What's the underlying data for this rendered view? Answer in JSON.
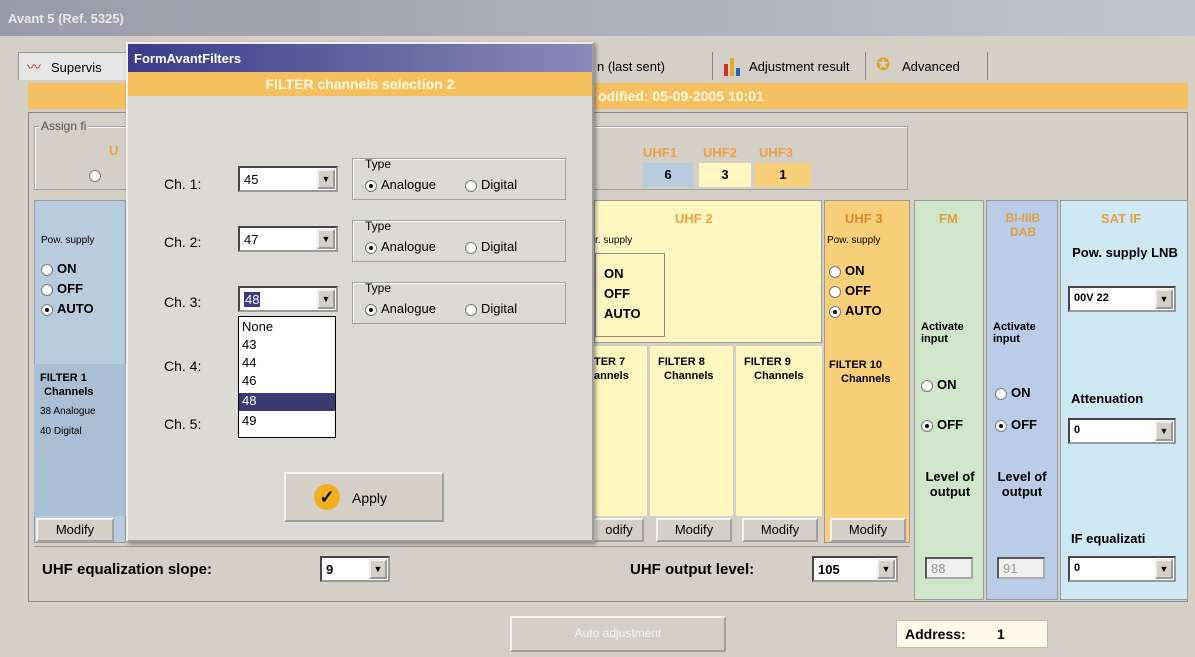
{
  "window": {
    "title": "Avant 5 (Ref. 5325)"
  },
  "tabs": [
    {
      "label": "Supervis",
      "icon": "waveform-icon"
    },
    {
      "label": "n (last sent)"
    },
    {
      "label": "Adjustment result",
      "icon": "bar-chart-icon"
    },
    {
      "label": "Advanced",
      "icon": "gear-icon"
    }
  ],
  "status": {
    "modified": "odified: 05-09-2005 10:01"
  },
  "assign_group": {
    "title": "Assign fi",
    "left_label": "U",
    "uhf_labels": [
      "UHF1",
      "UHF2",
      "UHF3"
    ],
    "uhf_values": [
      "6",
      "3",
      "1"
    ]
  },
  "bands": {
    "uhf2_title": "UHF 2",
    "uhf3_title": "UHF 3",
    "fm_title": "FM",
    "biiib_title": "BI-IIIB DAB",
    "satif_title": "SAT IF"
  },
  "pow_supply": {
    "label_left": "Pow. supply",
    "label_mid": "r. supply",
    "label_uhf3": "Pow. supply",
    "options": [
      "ON",
      "OFF",
      "AUTO"
    ],
    "selected": "AUTO"
  },
  "lnb": {
    "label": "Pow. supply LNB",
    "value": "00V 22"
  },
  "activate": {
    "label": "Activate input",
    "on": "ON",
    "off": "OFF"
  },
  "level": {
    "label": "Level of output",
    "fm_value": "88",
    "dab_value": "91"
  },
  "attenuation": {
    "label": "Attenuation",
    "value": "0"
  },
  "if_eq": {
    "label": "IF equalizati",
    "value": "0"
  },
  "filters": {
    "filter1": {
      "title": "FILTER 1",
      "sub": "Channels",
      "line1": "38 Analogue",
      "line2": "40 Digital"
    },
    "filter7": {
      "title": "TER 7",
      "sub": "annels"
    },
    "filter8": {
      "title": "FILTER 8",
      "sub": "Channels"
    },
    "filter9": {
      "title": "FILTER 9",
      "sub": "Channels"
    },
    "filter10": {
      "title": "FILTER 10",
      "sub": "Channels"
    },
    "modify": "Modify",
    "modify_partial": "odify"
  },
  "bottom": {
    "uhf_slope_label": "UHF equalization slope:",
    "uhf_slope_value": "9",
    "uhf_output_label": "UHF output level:",
    "uhf_output_value": "105",
    "auto_adjust": "Auto adjustment",
    "address_label": "Address:",
    "address_value": "1"
  },
  "dialog": {
    "title": "FormAvantFilters",
    "header": "FILTER channels selection 2",
    "rows": [
      {
        "label": "Ch. 1:",
        "value": "45",
        "type_label": "Type",
        "analogue": "Analogue",
        "digital": "Digital"
      },
      {
        "label": "Ch. 2:",
        "value": "47",
        "type_label": "Type",
        "analogue": "Analogue",
        "digital": "Digital"
      },
      {
        "label": "Ch. 3:",
        "value": "48",
        "type_label": "Type",
        "analogue": "Analogue",
        "digital": "Digital"
      },
      {
        "label": "Ch. 4:"
      },
      {
        "label": "Ch. 5:"
      }
    ],
    "dropdown_options": [
      "None",
      "43",
      "44",
      "46",
      "48",
      "49"
    ],
    "dropdown_selected": "48",
    "apply": "Apply"
  },
  "colors": {
    "accent_orange": "#f5c060",
    "uhf2_bg": "#fff6c0",
    "uhf3_bg": "#f9cf7a",
    "fm_bg": "#cfe6c8",
    "dab_bg": "#b9cde8",
    "sat_bg": "#cfe8f6",
    "filter1_bg": "#b8cce0"
  }
}
